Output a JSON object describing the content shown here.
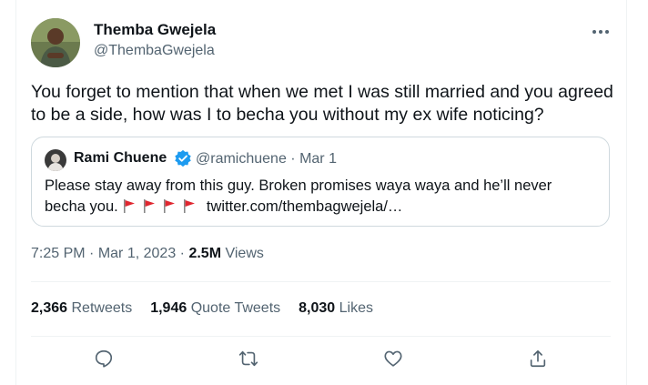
{
  "author": {
    "name": "Themba Gwejela",
    "handle": "@ThembaGwejela"
  },
  "tweet": {
    "text": "You forget to mention that when we met I was still married and you agreed to be a side, how was I to becha you without my ex wife noticing?",
    "time": "7:25 PM",
    "date": "Mar 1, 2023",
    "views_count": "2.5M",
    "views_label": "Views"
  },
  "quoted": {
    "name": "Rami Chuene",
    "handle": "@ramichuene",
    "date": "Mar 1",
    "text": "Please stay away from this guy. Broken promises waya waya and he’ll never becha you.",
    "link": "twitter.com/thembagwejela/…"
  },
  "stats": {
    "retweets_count": "2,366",
    "retweets_label": "Retweets",
    "quotes_count": "1,946",
    "quotes_label": "Quote Tweets",
    "likes_count": "8,030",
    "likes_label": "Likes"
  },
  "icons": {
    "more": "more-icon",
    "verified": "verified-badge-icon",
    "reply": "reply-icon",
    "retweet": "retweet-icon",
    "like": "heart-icon",
    "share": "share-icon",
    "flag": "red-flag-icon"
  },
  "colors": {
    "text": "#0f1419",
    "secondary": "#536471",
    "verified": "#1d9bf0",
    "flag": "#e0262f",
    "border": "#cfd9de"
  }
}
